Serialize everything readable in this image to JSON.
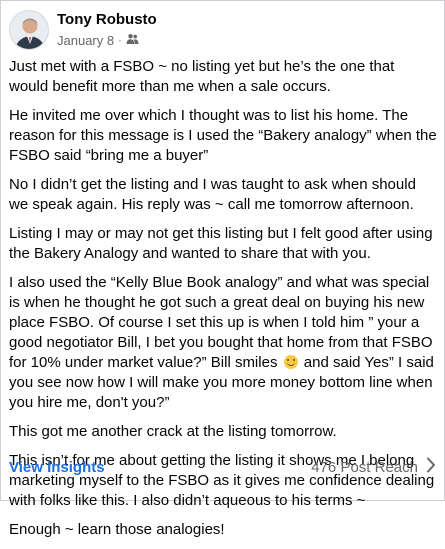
{
  "post": {
    "author": "Tony Robusto",
    "date": "January 8",
    "separator": "·",
    "privacy_icon": "group-icon",
    "paragraphs": [
      "Just met with a FSBO ~ no listing yet but he’s the one that would benefit more than me when a sale occurs.",
      "He invited me over which I thought was to list his home. The reason for this message is I used the “Bakery analogy” when the FSBO said “bring me a buyer”",
      "No I didn’t get the listing and I was taught to ask when should we speak again. His reply was ~ call me tomorrow afternoon.",
      "Listing I may or may not get this listing but I felt good after using the Bakery Analogy and wanted to share that with you."
    ],
    "paragraph5_before_emoji": "I also used the “Kelly Blue Book analogy” and what was special is when he thought he got such a great deal on buying his new place FSBO. Of course I set this up is when I told him ” your a good negotiator Bill, I bet you bought that home from that FSBO for 10% under market value?” Bill smiles",
    "paragraph5_after_emoji": "and said Yes” I said you see now how I will make you more money bottom line when you hire me, don't you?”",
    "emoji_icon": "smiling-face-icon",
    "paragraphs_end": [
      "This got me another crack at the listing tomorrow.",
      "This isn’t for me about getting the listing it shows me I belong marketing myself to the FSBO as it gives me confidence dealing with folks like this. I also didn’t aqueous to his terms ~",
      "Enough ~ learn those analogies!"
    ]
  },
  "footer": {
    "insights_label": "View Insights",
    "reach_label": "476 Post Reach",
    "chevron_icon": "chevron-right-icon"
  },
  "colors": {
    "link": "#216fdb",
    "secondary": "#65676b",
    "text": "#050505"
  }
}
